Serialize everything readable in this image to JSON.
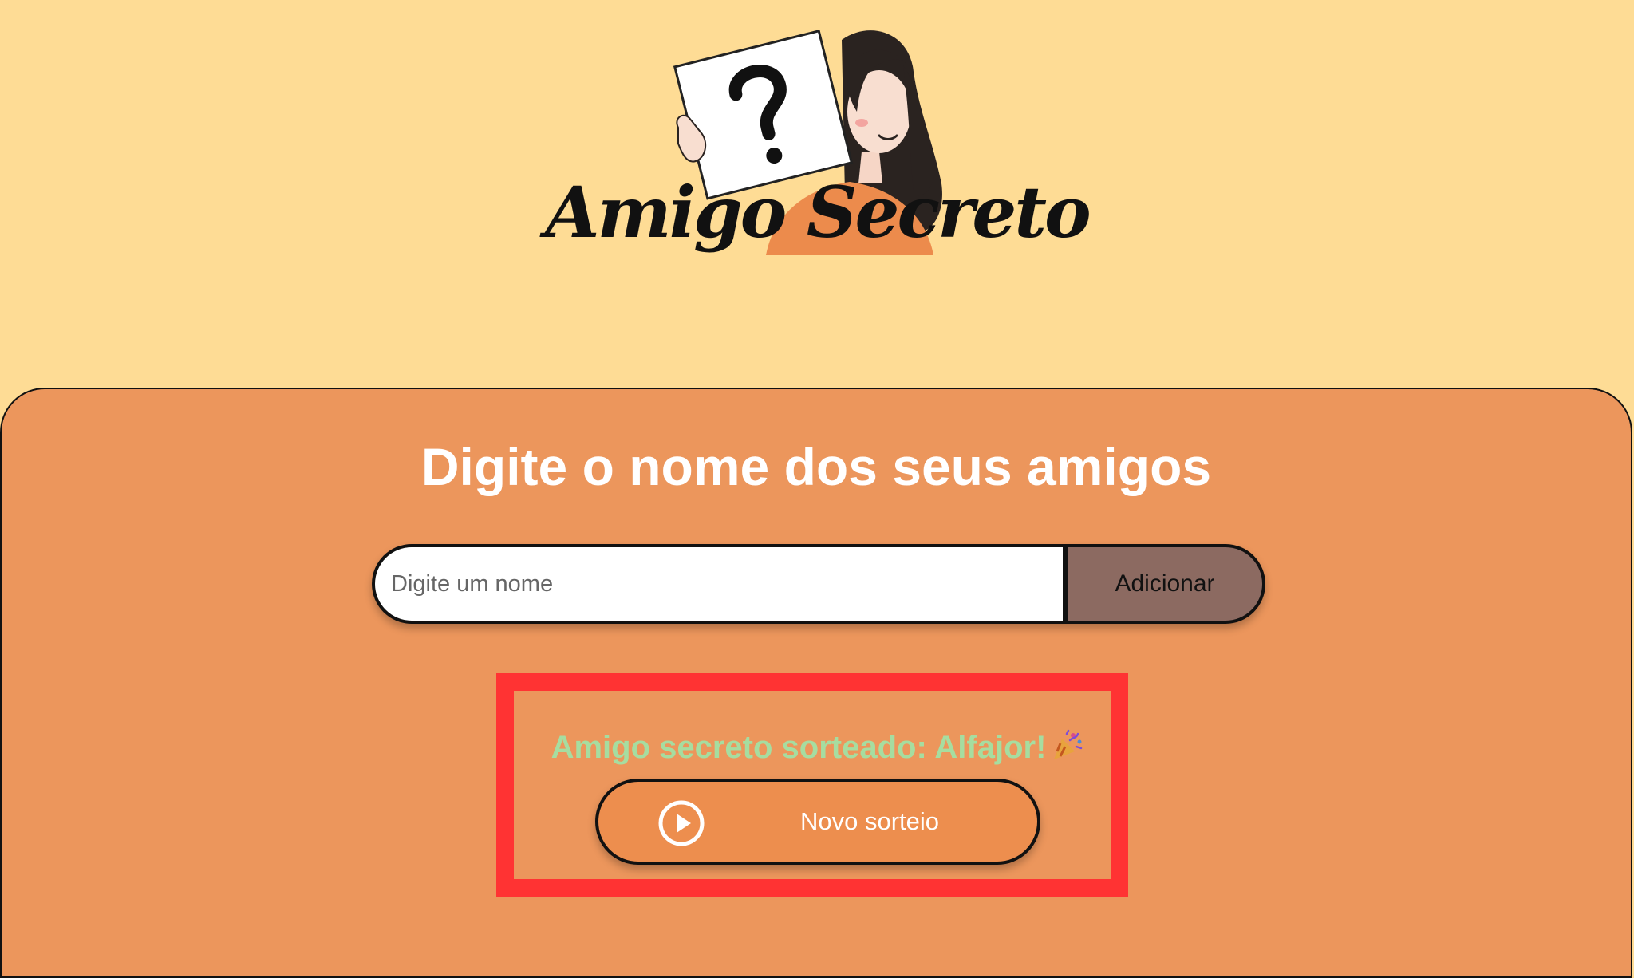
{
  "header": {
    "title": "Amigo Secreto",
    "illustration_icon": "person-holding-question-sign-illustration"
  },
  "main": {
    "section_title": "Digite o nome dos seus amigos",
    "name_input": {
      "value": "",
      "placeholder": "Digite um nome"
    },
    "add_button_label": "Adicionar",
    "result_text": "Amigo secreto sorteado: Alfajor!",
    "result_icon": "party-popper-icon",
    "draw_button": {
      "label": "Novo sorteio",
      "icon": "play-circle-icon"
    }
  },
  "colors": {
    "page_background": "#FEDC95",
    "panel_background": "#EC965C",
    "add_button": "#8C6A61",
    "draw_button": "#ED8E4E",
    "result_text": "#A6DDA0",
    "highlight_border": "#FF3333"
  }
}
